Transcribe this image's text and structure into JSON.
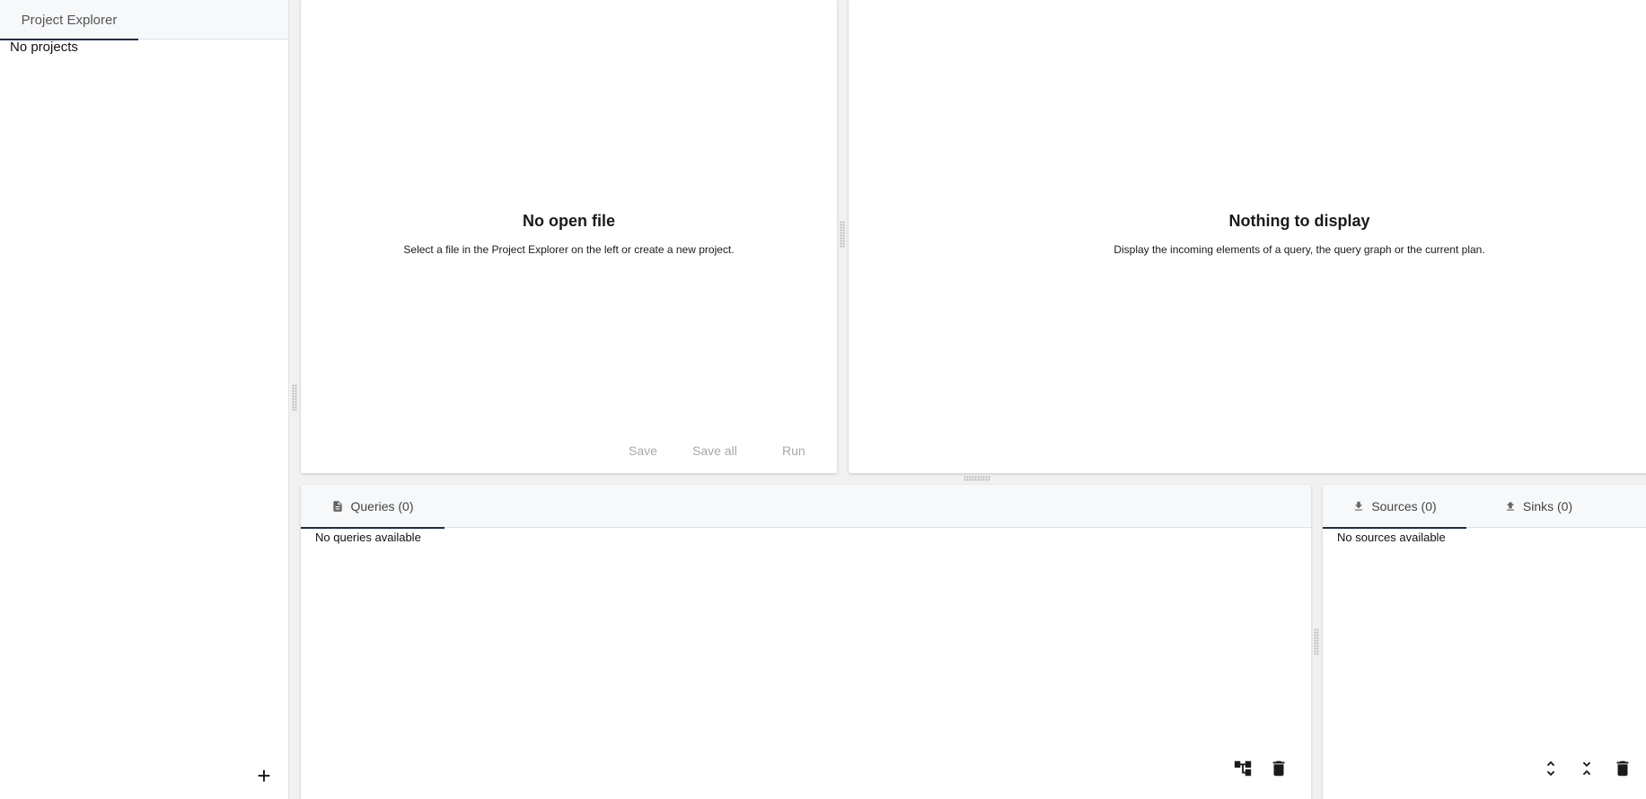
{
  "sidebar": {
    "tab_label": "Project Explorer",
    "empty_text": "No projects",
    "add_label": "+"
  },
  "editor": {
    "empty_title": "No open file",
    "empty_subtitle": "Select a file in the Project Explorer on the left or create a new project.",
    "save_label": "Save",
    "save_all_label": "Save all",
    "run_label": "Run"
  },
  "viewer": {
    "empty_title": "Nothing to display",
    "empty_subtitle": "Display the incoming elements of a query, the query graph or the current plan."
  },
  "queries": {
    "tab_label": "Queries (0)",
    "empty_text": "No queries available",
    "icons": [
      "tree-structure-icon",
      "trash-icon"
    ]
  },
  "sources": {
    "sources_tab_label": "Sources (0)",
    "sinks_tab_label": "Sinks (0)",
    "empty_text": "No sources available",
    "icons": [
      "expand-all-icon",
      "collapse-all-icon",
      "trash-icon"
    ]
  },
  "colors": {
    "accent": "#1d2c4f",
    "disabled_text": "#a8a8a8",
    "tabbar_bg": "#f7f8fa",
    "app_bg": "#f1f1f1"
  }
}
